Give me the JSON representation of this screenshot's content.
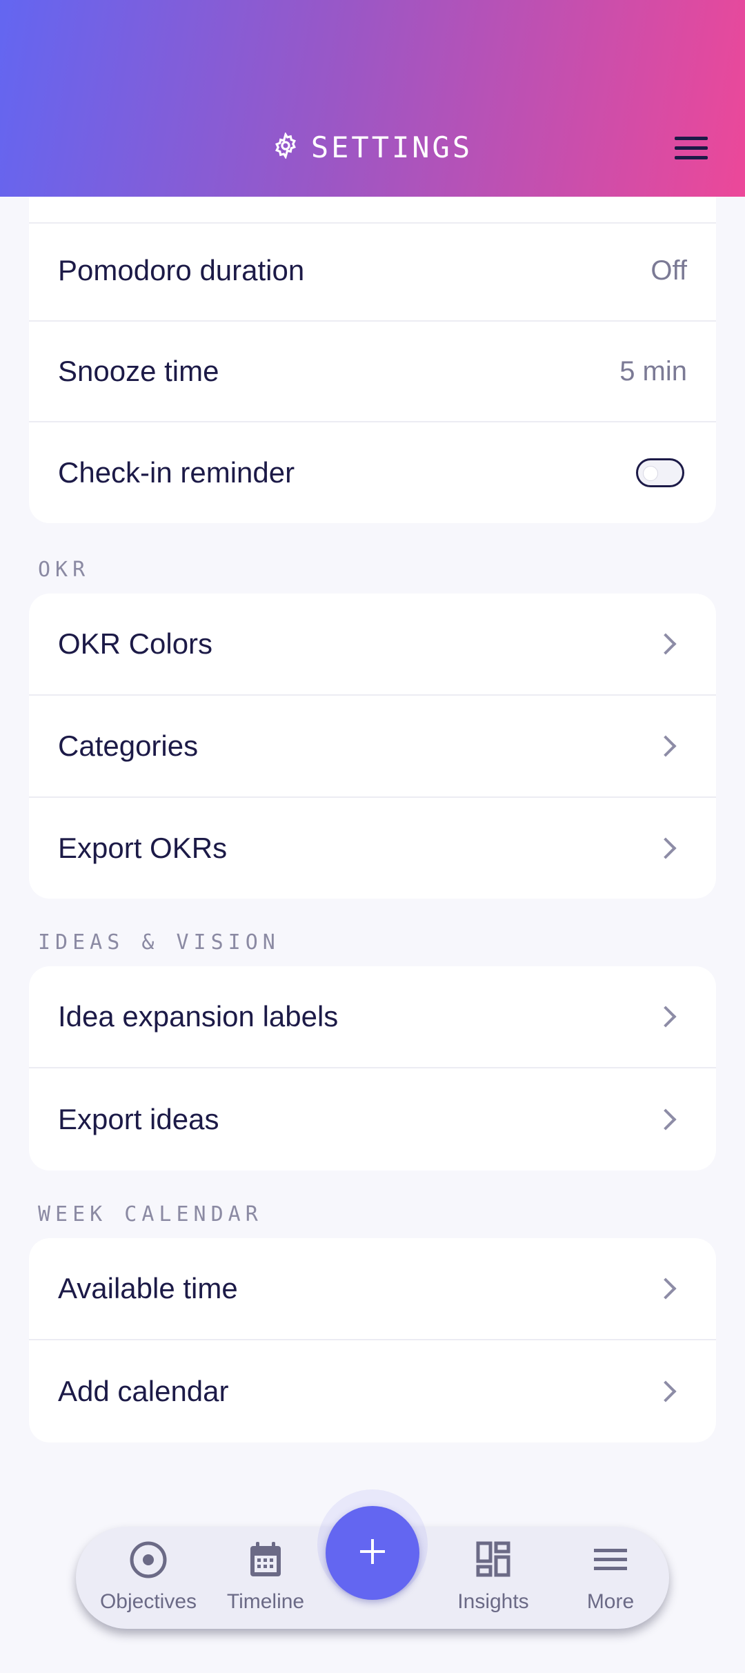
{
  "header": {
    "title": "SETTINGS",
    "icon": "gear-icon",
    "menu_icon": "hamburger-menu-icon"
  },
  "timer_settings": {
    "rows": [
      {
        "label": "Pomodoro duration",
        "value": "Off"
      },
      {
        "label": "Snooze time",
        "value": "5 min"
      },
      {
        "label": "Check-in reminder",
        "toggle": false
      }
    ]
  },
  "okr": {
    "section_title": "OKR",
    "rows": [
      {
        "label": "OKR Colors"
      },
      {
        "label": "Categories"
      },
      {
        "label": "Export OKRs"
      }
    ]
  },
  "ideas": {
    "section_title": "IDEAS & VISION",
    "rows": [
      {
        "label": "Idea expansion labels"
      },
      {
        "label": "Export ideas"
      }
    ]
  },
  "calendar": {
    "section_title": "WEEK CALENDAR",
    "rows": [
      {
        "label": "Available time"
      },
      {
        "label": "Add calendar"
      }
    ]
  },
  "bottom_nav": {
    "items": [
      {
        "label": "Objectives",
        "icon": "target-icon"
      },
      {
        "label": "Timeline",
        "icon": "calendar-icon"
      },
      {
        "label": "Insights",
        "icon": "dashboard-icon"
      },
      {
        "label": "More",
        "icon": "menu-lines-icon"
      }
    ],
    "fab_icon": "plus-icon"
  },
  "colors": {
    "accent": "#6366f1",
    "header_gradient_start": "#6366f1",
    "header_gradient_end": "#ec4899",
    "text_primary": "#1c1a47",
    "text_secondary": "#7b7a95",
    "background": "#f7f7fc"
  }
}
